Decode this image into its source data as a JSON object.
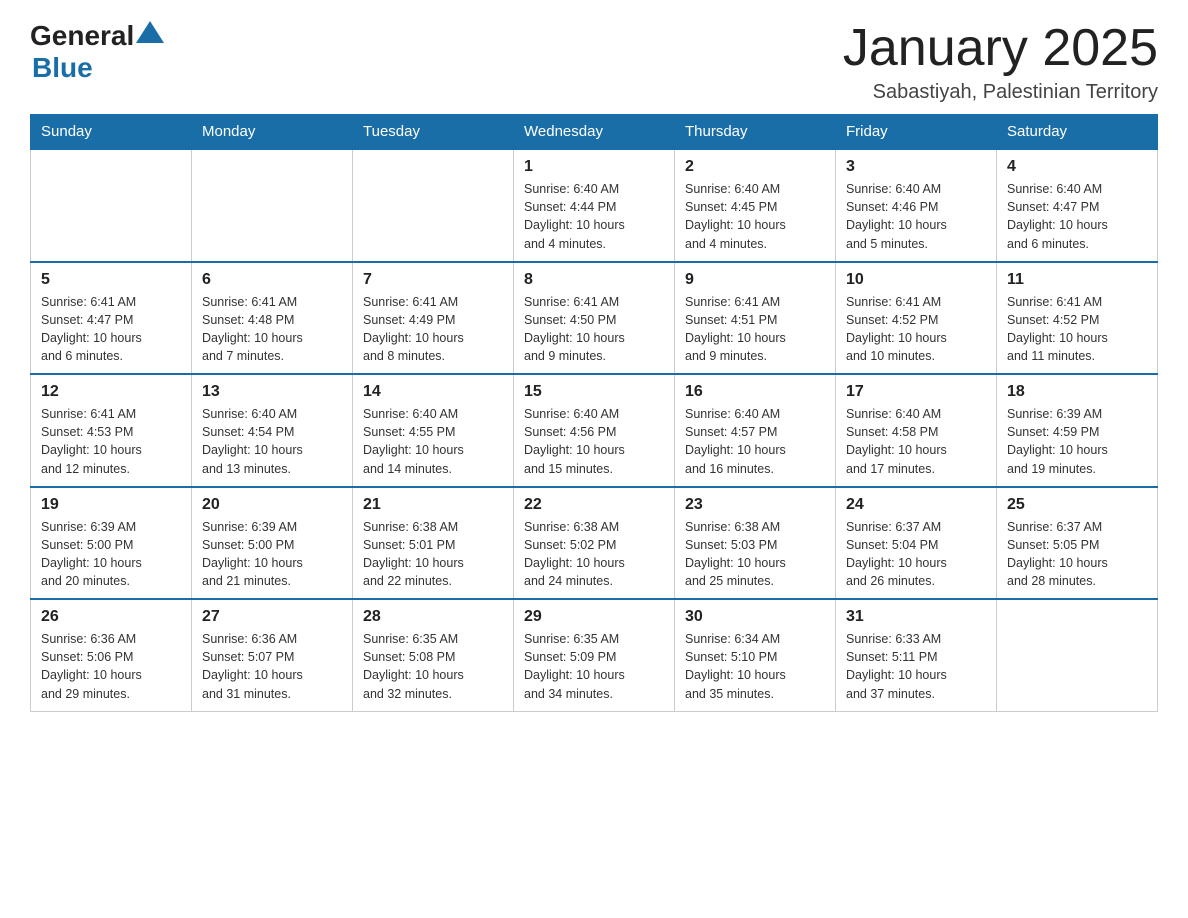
{
  "header": {
    "logo_text_general": "General",
    "logo_text_blue": "Blue",
    "title": "January 2025",
    "subtitle": "Sabastiyah, Palestinian Territory"
  },
  "days_of_week": [
    "Sunday",
    "Monday",
    "Tuesday",
    "Wednesday",
    "Thursday",
    "Friday",
    "Saturday"
  ],
  "weeks": [
    [
      {
        "day": "",
        "info": ""
      },
      {
        "day": "",
        "info": ""
      },
      {
        "day": "",
        "info": ""
      },
      {
        "day": "1",
        "info": "Sunrise: 6:40 AM\nSunset: 4:44 PM\nDaylight: 10 hours\nand 4 minutes."
      },
      {
        "day": "2",
        "info": "Sunrise: 6:40 AM\nSunset: 4:45 PM\nDaylight: 10 hours\nand 4 minutes."
      },
      {
        "day": "3",
        "info": "Sunrise: 6:40 AM\nSunset: 4:46 PM\nDaylight: 10 hours\nand 5 minutes."
      },
      {
        "day": "4",
        "info": "Sunrise: 6:40 AM\nSunset: 4:47 PM\nDaylight: 10 hours\nand 6 minutes."
      }
    ],
    [
      {
        "day": "5",
        "info": "Sunrise: 6:41 AM\nSunset: 4:47 PM\nDaylight: 10 hours\nand 6 minutes."
      },
      {
        "day": "6",
        "info": "Sunrise: 6:41 AM\nSunset: 4:48 PM\nDaylight: 10 hours\nand 7 minutes."
      },
      {
        "day": "7",
        "info": "Sunrise: 6:41 AM\nSunset: 4:49 PM\nDaylight: 10 hours\nand 8 minutes."
      },
      {
        "day": "8",
        "info": "Sunrise: 6:41 AM\nSunset: 4:50 PM\nDaylight: 10 hours\nand 9 minutes."
      },
      {
        "day": "9",
        "info": "Sunrise: 6:41 AM\nSunset: 4:51 PM\nDaylight: 10 hours\nand 9 minutes."
      },
      {
        "day": "10",
        "info": "Sunrise: 6:41 AM\nSunset: 4:52 PM\nDaylight: 10 hours\nand 10 minutes."
      },
      {
        "day": "11",
        "info": "Sunrise: 6:41 AM\nSunset: 4:52 PM\nDaylight: 10 hours\nand 11 minutes."
      }
    ],
    [
      {
        "day": "12",
        "info": "Sunrise: 6:41 AM\nSunset: 4:53 PM\nDaylight: 10 hours\nand 12 minutes."
      },
      {
        "day": "13",
        "info": "Sunrise: 6:40 AM\nSunset: 4:54 PM\nDaylight: 10 hours\nand 13 minutes."
      },
      {
        "day": "14",
        "info": "Sunrise: 6:40 AM\nSunset: 4:55 PM\nDaylight: 10 hours\nand 14 minutes."
      },
      {
        "day": "15",
        "info": "Sunrise: 6:40 AM\nSunset: 4:56 PM\nDaylight: 10 hours\nand 15 minutes."
      },
      {
        "day": "16",
        "info": "Sunrise: 6:40 AM\nSunset: 4:57 PM\nDaylight: 10 hours\nand 16 minutes."
      },
      {
        "day": "17",
        "info": "Sunrise: 6:40 AM\nSunset: 4:58 PM\nDaylight: 10 hours\nand 17 minutes."
      },
      {
        "day": "18",
        "info": "Sunrise: 6:39 AM\nSunset: 4:59 PM\nDaylight: 10 hours\nand 19 minutes."
      }
    ],
    [
      {
        "day": "19",
        "info": "Sunrise: 6:39 AM\nSunset: 5:00 PM\nDaylight: 10 hours\nand 20 minutes."
      },
      {
        "day": "20",
        "info": "Sunrise: 6:39 AM\nSunset: 5:00 PM\nDaylight: 10 hours\nand 21 minutes."
      },
      {
        "day": "21",
        "info": "Sunrise: 6:38 AM\nSunset: 5:01 PM\nDaylight: 10 hours\nand 22 minutes."
      },
      {
        "day": "22",
        "info": "Sunrise: 6:38 AM\nSunset: 5:02 PM\nDaylight: 10 hours\nand 24 minutes."
      },
      {
        "day": "23",
        "info": "Sunrise: 6:38 AM\nSunset: 5:03 PM\nDaylight: 10 hours\nand 25 minutes."
      },
      {
        "day": "24",
        "info": "Sunrise: 6:37 AM\nSunset: 5:04 PM\nDaylight: 10 hours\nand 26 minutes."
      },
      {
        "day": "25",
        "info": "Sunrise: 6:37 AM\nSunset: 5:05 PM\nDaylight: 10 hours\nand 28 minutes."
      }
    ],
    [
      {
        "day": "26",
        "info": "Sunrise: 6:36 AM\nSunset: 5:06 PM\nDaylight: 10 hours\nand 29 minutes."
      },
      {
        "day": "27",
        "info": "Sunrise: 6:36 AM\nSunset: 5:07 PM\nDaylight: 10 hours\nand 31 minutes."
      },
      {
        "day": "28",
        "info": "Sunrise: 6:35 AM\nSunset: 5:08 PM\nDaylight: 10 hours\nand 32 minutes."
      },
      {
        "day": "29",
        "info": "Sunrise: 6:35 AM\nSunset: 5:09 PM\nDaylight: 10 hours\nand 34 minutes."
      },
      {
        "day": "30",
        "info": "Sunrise: 6:34 AM\nSunset: 5:10 PM\nDaylight: 10 hours\nand 35 minutes."
      },
      {
        "day": "31",
        "info": "Sunrise: 6:33 AM\nSunset: 5:11 PM\nDaylight: 10 hours\nand 37 minutes."
      },
      {
        "day": "",
        "info": ""
      }
    ]
  ]
}
